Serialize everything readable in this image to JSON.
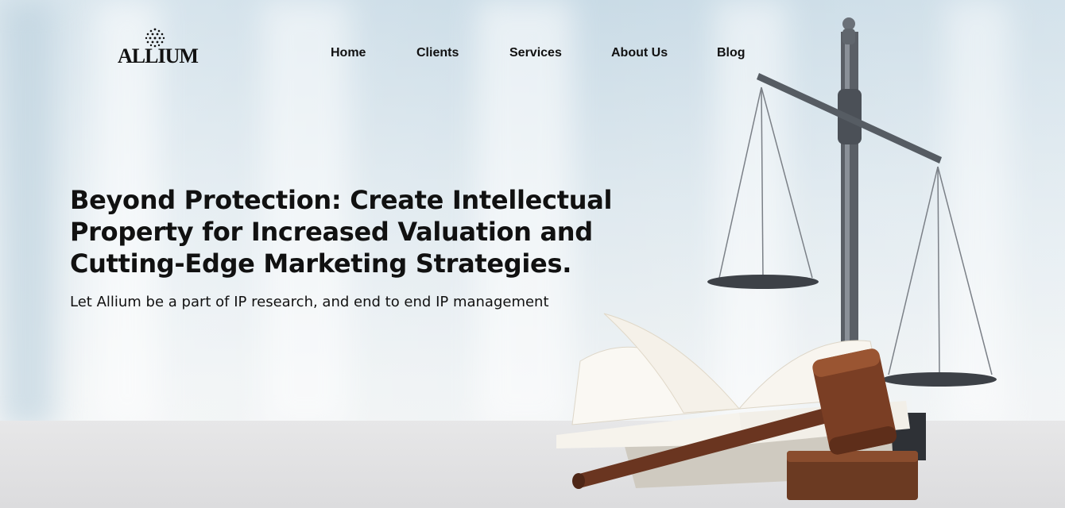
{
  "brand": {
    "name": "ALLIUM",
    "logo_icon": "dotted-sphere-icon"
  },
  "nav": {
    "items": [
      {
        "label": "Home"
      },
      {
        "label": "Clients"
      },
      {
        "label": "Services"
      },
      {
        "label": "About Us"
      },
      {
        "label": "Blog"
      }
    ]
  },
  "hero": {
    "headline": "Beyond Protection: Create Intellectual Property for Increased Valuation and Cutting-Edge Marketing Strategies.",
    "subheading": "Let Allium be a part of IP research, and end to end IP management"
  }
}
